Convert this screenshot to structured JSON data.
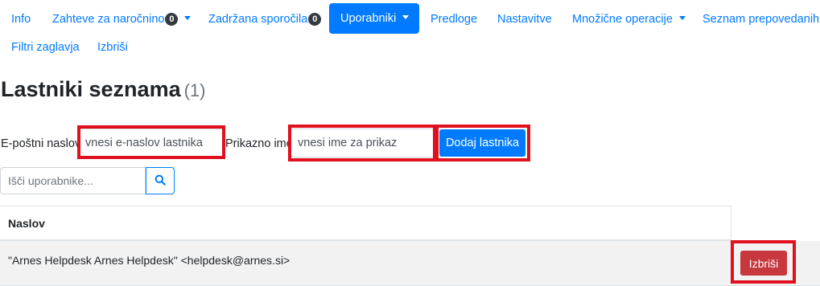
{
  "nav": {
    "items": [
      {
        "label": "Info"
      },
      {
        "label": "Zahteve za naročnino",
        "badge": "0",
        "dropdown": true
      },
      {
        "label": "Zadržana sporočila",
        "badge": "0"
      },
      {
        "label": "Uporabniki",
        "active": true,
        "dropdown": true
      },
      {
        "label": "Predloge"
      },
      {
        "label": "Nastavitve"
      },
      {
        "label": "Množične operacije",
        "dropdown": true
      },
      {
        "label": "Seznam prepovedanih"
      },
      {
        "label": "Filtri zaglavja"
      },
      {
        "label": "Izbriši"
      }
    ]
  },
  "page": {
    "title": "Lastniki seznama",
    "count": "(1)"
  },
  "add_owner_form": {
    "email_label": "E-poštni naslov",
    "email_placeholder": "vnesi e-naslov lastnika",
    "display_name_label": "Prikazno ime",
    "display_name_placeholder": "vnesi ime za prikaz",
    "add_button": "Dodaj lastnika"
  },
  "search": {
    "placeholder": "Išči uporabnike...",
    "icon": "search-icon"
  },
  "table": {
    "header": "Naslov",
    "rows": [
      {
        "address": "\"Arnes Helpdesk Arnes Helpdesk\" <helpdesk@arnes.si>",
        "delete_label": "Izbriši"
      }
    ]
  },
  "colors": {
    "primary": "#007bff",
    "danger": "#c6373e",
    "highlight_frame": "#e0101e",
    "badge": "#343a40"
  }
}
